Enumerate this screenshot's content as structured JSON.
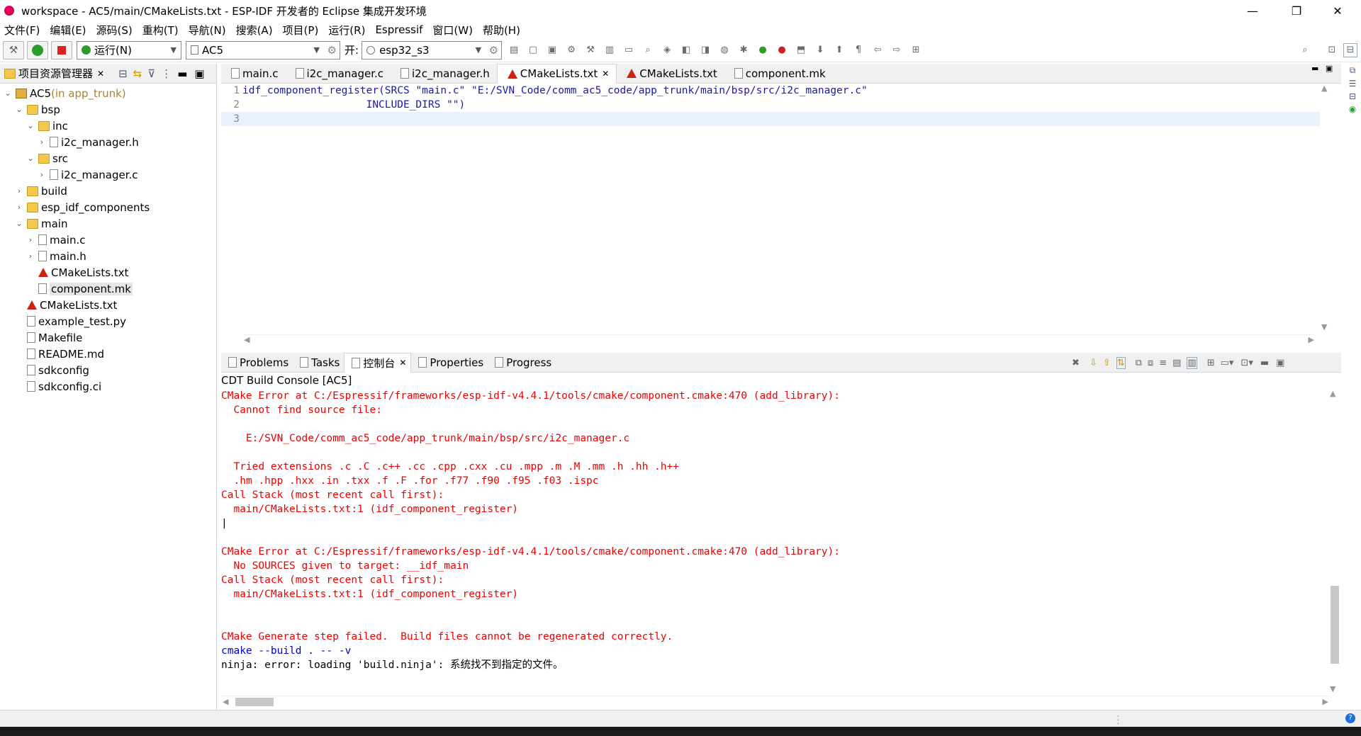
{
  "window": {
    "title": "workspace - AC5/main/CMakeLists.txt - ESP-IDF 开发者的 Eclipse 集成开发环境",
    "minimize": "—",
    "restore": "❐",
    "close": "✕"
  },
  "menu": [
    "文件(F)",
    "编辑(E)",
    "源码(S)",
    "重构(T)",
    "导航(N)",
    "搜索(A)",
    "项目(P)",
    "运行(R)",
    "Espressif",
    "窗口(W)",
    "帮助(H)"
  ],
  "toolbar": {
    "run_mode": "运行(N)",
    "launch_config": "AC5",
    "on_label": "开:",
    "target": "esp32_s3"
  },
  "project_explorer": {
    "tab_label": "项目资源管理器",
    "tree": [
      {
        "depth": 0,
        "twisty": "v",
        "icon": "project",
        "label": "AC5",
        "suffix": " (in app_trunk)"
      },
      {
        "depth": 1,
        "twisty": "v",
        "icon": "folder",
        "label": "bsp"
      },
      {
        "depth": 2,
        "twisty": "v",
        "icon": "folder",
        "label": "inc"
      },
      {
        "depth": 3,
        "twisty": ">",
        "icon": "file",
        "label": "i2c_manager.h"
      },
      {
        "depth": 2,
        "twisty": "v",
        "icon": "folder",
        "label": "src"
      },
      {
        "depth": 3,
        "twisty": ">",
        "icon": "file",
        "label": "i2c_manager.c"
      },
      {
        "depth": 1,
        "twisty": ">",
        "icon": "folder",
        "label": "build"
      },
      {
        "depth": 1,
        "twisty": ">",
        "icon": "folder",
        "label": "esp_idf_components"
      },
      {
        "depth": 1,
        "twisty": "v",
        "icon": "folder",
        "label": "main"
      },
      {
        "depth": 2,
        "twisty": ">",
        "icon": "file",
        "label": "main.c"
      },
      {
        "depth": 2,
        "twisty": ">",
        "icon": "file",
        "label": "main.h"
      },
      {
        "depth": 2,
        "twisty": "",
        "icon": "cmake",
        "label": "CMakeLists.txt"
      },
      {
        "depth": 2,
        "twisty": "",
        "icon": "file",
        "label": "component.mk",
        "selected": true
      },
      {
        "depth": 1,
        "twisty": "",
        "icon": "cmake",
        "label": "CMakeLists.txt"
      },
      {
        "depth": 1,
        "twisty": "",
        "icon": "file",
        "label": "example_test.py"
      },
      {
        "depth": 1,
        "twisty": "",
        "icon": "file",
        "label": "Makefile"
      },
      {
        "depth": 1,
        "twisty": "",
        "icon": "file",
        "label": "README.md"
      },
      {
        "depth": 1,
        "twisty": "",
        "icon": "file",
        "label": "sdkconfig"
      },
      {
        "depth": 1,
        "twisty": "",
        "icon": "file",
        "label": "sdkconfig.ci"
      }
    ]
  },
  "editor": {
    "tabs": [
      {
        "label": "main.c",
        "icon": "file"
      },
      {
        "label": "i2c_manager.c",
        "icon": "file"
      },
      {
        "label": "i2c_manager.h",
        "icon": "file"
      },
      {
        "label": "CMakeLists.txt",
        "icon": "cmake",
        "active": true
      },
      {
        "label": "CMakeLists.txt",
        "icon": "cmake"
      },
      {
        "label": "component.mk",
        "icon": "file"
      }
    ],
    "lines": [
      {
        "num": "1",
        "code": "idf_component_register(SRCS \"main.c\" \"E:/SVN_Code/comm_ac5_code/app_trunk/main/bsp/src/i2c_manager.c\""
      },
      {
        "num": "2",
        "code": "                    INCLUDE_DIRS \"\")"
      },
      {
        "num": "3",
        "code": ""
      }
    ]
  },
  "bottom_panel": {
    "tabs": [
      "Problems",
      "Tasks",
      "控制台",
      "Properties",
      "Progress"
    ],
    "console_title": "CDT Build Console [AC5]",
    "console_lines": [
      {
        "c": "red",
        "t": "CMake Error at C:/Espressif/frameworks/esp-idf-v4.4.1/tools/cmake/component.cmake:470 (add_library):"
      },
      {
        "c": "red",
        "t": "  Cannot find source file:"
      },
      {
        "c": "red",
        "t": ""
      },
      {
        "c": "red",
        "t": "    E:/SVN_Code/comm_ac5_code/app_trunk/main/bsp/src/i2c_manager.c"
      },
      {
        "c": "red",
        "t": ""
      },
      {
        "c": "red",
        "t": "  Tried extensions .c .C .c++ .cc .cpp .cxx .cu .mpp .m .M .mm .h .hh .h++"
      },
      {
        "c": "red",
        "t": "  .hm .hpp .hxx .in .txx .f .F .for .f77 .f90 .f95 .f03 .ispc"
      },
      {
        "c": "red",
        "t": "Call Stack (most recent call first):"
      },
      {
        "c": "red",
        "t": "  main/CMakeLists.txt:1 (idf_component_register)"
      },
      {
        "c": "black",
        "t": "|"
      },
      {
        "c": "red",
        "t": ""
      },
      {
        "c": "red",
        "t": "CMake Error at C:/Espressif/frameworks/esp-idf-v4.4.1/tools/cmake/component.cmake:470 (add_library):"
      },
      {
        "c": "red",
        "t": "  No SOURCES given to target: __idf_main"
      },
      {
        "c": "red",
        "t": "Call Stack (most recent call first):"
      },
      {
        "c": "red",
        "t": "  main/CMakeLists.txt:1 (idf_component_register)"
      },
      {
        "c": "red",
        "t": ""
      },
      {
        "c": "red",
        "t": ""
      },
      {
        "c": "red",
        "t": "CMake Generate step failed.  Build files cannot be regenerated correctly."
      },
      {
        "c": "blue",
        "t": "cmake --build . -- -v"
      },
      {
        "c": "black",
        "t": "ninja: error: loading 'build.ninja': 系统找不到指定的文件。"
      }
    ]
  }
}
